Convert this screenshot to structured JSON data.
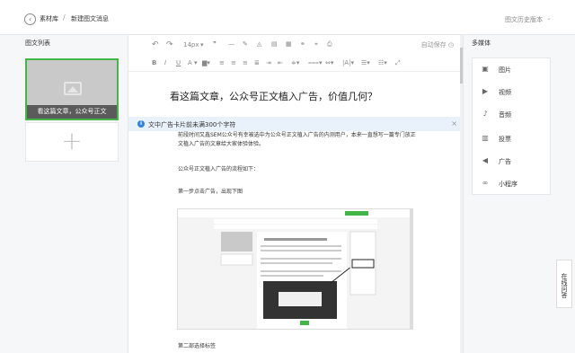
{
  "header": {
    "back_label": "素材库",
    "separator": "/",
    "page_title": "新建图文消息",
    "history_label": "图文历史版本"
  },
  "left_panel": {
    "title": "图文列表",
    "articles": [
      {
        "caption": "看这篇文章，公众号正文"
      }
    ],
    "add_label": "+"
  },
  "toolbar": {
    "undo": "↶",
    "redo": "↷",
    "font_size": "14px",
    "font_size_arrow": "▾",
    "autosave_label": "自动保存",
    "row2": [
      "B",
      "I",
      "U",
      "A",
      "▾"
    ]
  },
  "editor": {
    "article_title": "看这篇文章，公众号正文植入广告，价值几何？",
    "notice_text": "文中广告卡片前未满300个字符",
    "notice_close": "×",
    "paragraphs": [
      "前段时间又鑫SEM公众号有幸被选中为公众号正文植入广告的内测用户，本来一直想写一篇专门放正文植入广告的文章给大家体验体验。",
      "公众号正文植入广告的流程如下：",
      "第一步点击广告，出现下图",
      "第二部选择标签"
    ]
  },
  "right_panel": {
    "title": "多媒体",
    "items": [
      {
        "icon": "image-icon",
        "glyph": "▣",
        "label": "图片"
      },
      {
        "icon": "video-icon",
        "glyph": "▶",
        "label": "视频"
      },
      {
        "icon": "audio-icon",
        "glyph": "♪",
        "label": "音频"
      },
      {
        "icon": "vote-icon",
        "glyph": "▥",
        "label": "投票"
      },
      {
        "icon": "ad-icon",
        "glyph": "◀",
        "label": "广告"
      },
      {
        "icon": "miniprogram-icon",
        "glyph": "∞",
        "label": "小程序"
      }
    ]
  },
  "online_help": "在线问答",
  "colors": {
    "accent_green": "#44b549",
    "notice_blue": "#2f85e0"
  }
}
